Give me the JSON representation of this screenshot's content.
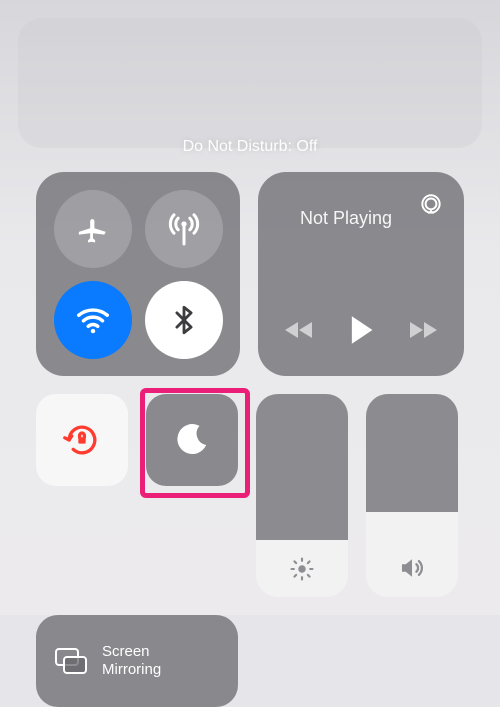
{
  "status_label": "Do Not Disturb: Off",
  "connectivity": {
    "airplane": "airplane-icon",
    "cellular": "cellular-icon",
    "wifi": "wifi-icon",
    "bluetooth": "bluetooth-icon"
  },
  "media": {
    "title": "Not Playing",
    "airplay": "airplay-icon"
  },
  "toggles": {
    "rotation_lock": "rotation-lock-icon",
    "do_not_disturb": "moon-icon"
  },
  "sliders": {
    "brightness": {
      "level_percent": 28
    },
    "volume": {
      "level_percent": 42
    }
  },
  "screen_mirroring": {
    "label": "Screen Mirroring"
  },
  "colors": {
    "accent_blue": "#0a7aff",
    "highlight_pink": "#ec1f78",
    "lock_red": "#ff3b30"
  }
}
